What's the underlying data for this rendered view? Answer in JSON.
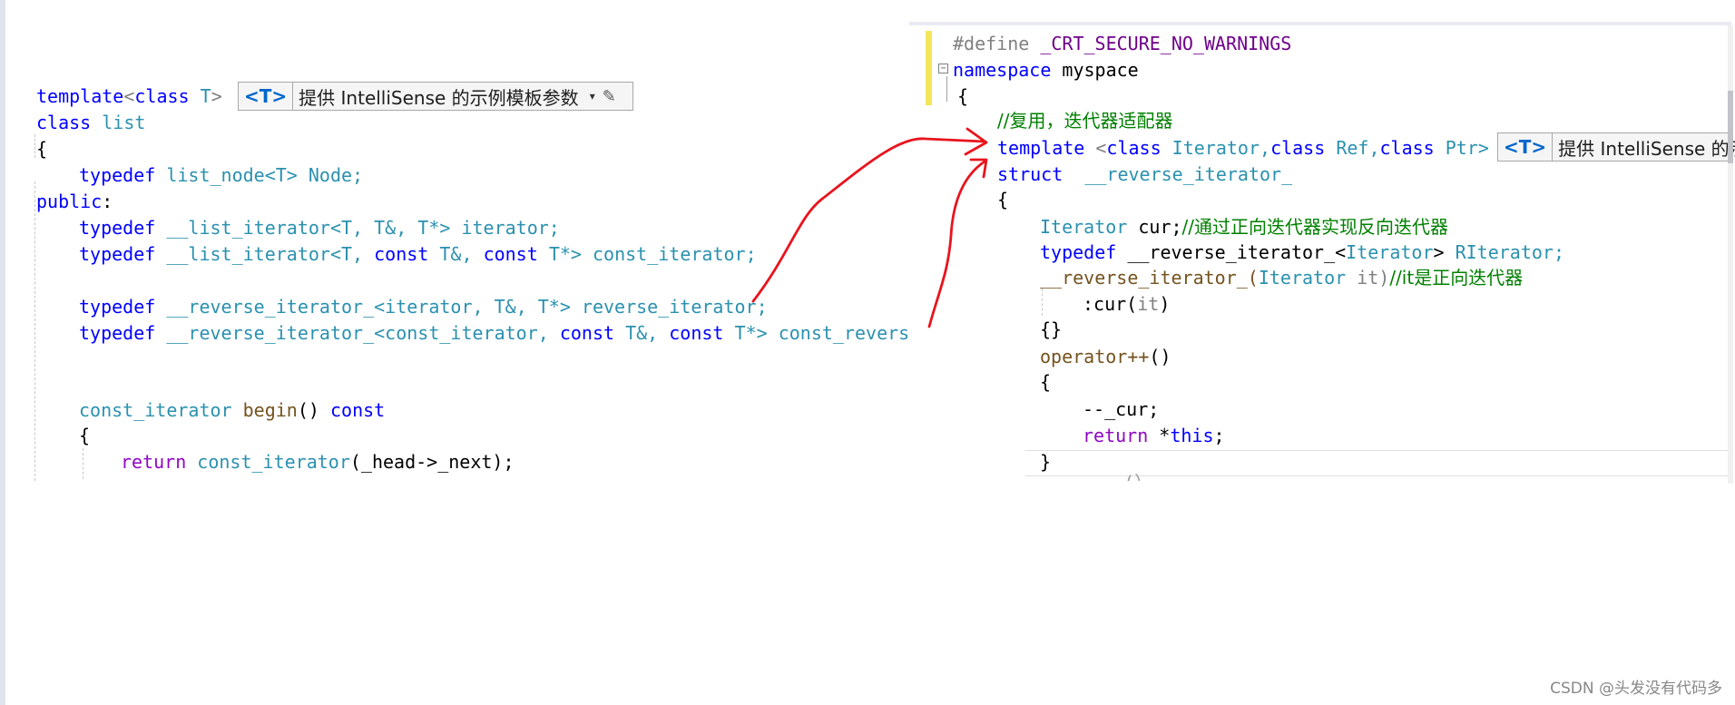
{
  "left_code": {
    "l1_template": "template",
    "l1_lt": "<",
    "l1_class": "class",
    "l1_T": "T",
    "l1_gt": ">",
    "l2_class": "class",
    "l2_list": "list",
    "l3": "{",
    "l4_typedef": "typedef",
    "l4_type": "list_node<T>",
    "l4_name": "Node;",
    "l5_public": "public",
    "l5_colon": ":",
    "l6_typedef": "typedef",
    "l6_type": "__list_iterator<T, T&, T*>",
    "l6_name": "iterator;",
    "l7_typedef": "typedef",
    "l7_a": "__list_iterator<T, ",
    "l7_const1": "const",
    "l7_b": " T&, ",
    "l7_const2": "const",
    "l7_c": " T*>",
    "l7_name": "const_iterator;",
    "l8_typedef": "typedef",
    "l8_type": "__reverse_iterator_<iterator, T&, T*>",
    "l8_name": "reverse_iterator;",
    "l9_typedef": "typedef",
    "l9_a": "__reverse_iterator_<const_iterator, ",
    "l9_const1": "const",
    "l9_b": " T&, ",
    "l9_const2": "const",
    "l9_c": " T*>",
    "l9_name": "const_reverse_iterator;",
    "l10_type": "const_iterator",
    "l10_fn": "begin",
    "l10_paren": "()",
    "l10_const": "const",
    "l11": "{",
    "l12_return": "return",
    "l12_type": "const_iterator",
    "l12_rest": "(_head->_next);"
  },
  "left_hint": {
    "tag": "<T>",
    "text": "提供 IntelliSense 的示例模板参数",
    "dropdown": "▾",
    "edit": "✎"
  },
  "right_code": {
    "r1_define": "#define",
    "r1_macro": "_CRT_SECURE_NO_WARNINGS",
    "r2_namespace": "namespace",
    "r2_name": "myspace",
    "r3": "{",
    "r4_comment": "//复用，迭代器适配器",
    "r5_template": "template",
    "r5_a": " <",
    "r5_class1": "class",
    "r5_b": " Iterator,",
    "r5_class2": "class",
    "r5_c": " Ref,",
    "r5_class3": "class",
    "r5_d": " Ptr>",
    "r6_struct": "struct",
    "r6_name": "__reverse_iterator_",
    "r7": "{",
    "r8_type": "Iterator",
    "r8_name": " cur;",
    "r8_comment": "//通过正向迭代器实现反向迭代器",
    "r9_typedef": "typedef",
    "r9_a": " __reverse_iterator_<",
    "r9_b": "Iterator",
    "r9_c": "> ",
    "r9_name": "RIterator;",
    "r10_ctor": "__reverse_iterator_(",
    "r10_type": "Iterator",
    "r10_param": " it)",
    "r10_comment": "//it是正向迭代器",
    "r11_a": ":cur(",
    "r11_it": "it",
    "r11_b": ")",
    "r12": "{}",
    "r13_op": "operator++",
    "r13_paren": "()",
    "r14": "{",
    "r15": "--_cur;",
    "r16_return": "return",
    "r16_a": " *",
    "r16_this": "this",
    "r16_b": ";",
    "r17": "}",
    "r18_partial": "...(）"
  },
  "right_hint": {
    "tag": "<T>",
    "text": "提供 IntelliSense 的示"
  },
  "annotation": {
    "color": "#e8141e"
  },
  "watermark": "CSDN @头发没有代码多"
}
